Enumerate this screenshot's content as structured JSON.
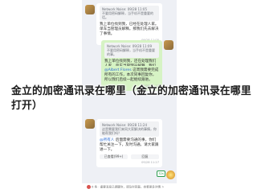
{
  "chat": {
    "msg1": {
      "quote": "Network Noise: 09/28 11:05",
      "quote2": "不要用密码解释，当手机不是重要的话。",
      "text": "我上单位找到我，已经在处理人家。单车当管理员解释。那我们先去解决了事情。",
      "time": "09/28 11:05"
    },
    "msg2": {
      "quote": "Network Noise: 09/28 11:09",
      "quote2": "不要用密码解释，当手机不是重要的事。",
      "text": "我上单位找到我，还在处理我们人家，单车当管理员解释，我们一起处理。",
      "time": "09/28 11:09"
    },
    "msg3": {
      "mention": "@Albert Flores",
      "text": "这周我需要完成所有的工作，本次同事回复你，所以我们后续一起继续跟进。",
      "time": "09/28 11:13"
    },
    "msg4": {
      "quote": "Network Noise: 09/28 11:24",
      "quote2": "这是需要我们来同大家解决的事情，你能帮我们吗？",
      "mention": "@所有人",
      "text": "后面需要沟通的事，你们帮忙关注一下，及时沟通。请大家跟进一下。",
      "btn1": "已查看(99+)",
      "btn2": "回复",
      "time": "09/28 11:27"
    },
    "msg5": {
      "text": "32s"
    },
    "footer": "6 条 · 重要消息已提醒你，请及时回复。查看更多详情 >"
  },
  "overlay": {
    "title": "金立的加密通讯录在哪里（金立的加密通讯录在哪里打开）"
  }
}
